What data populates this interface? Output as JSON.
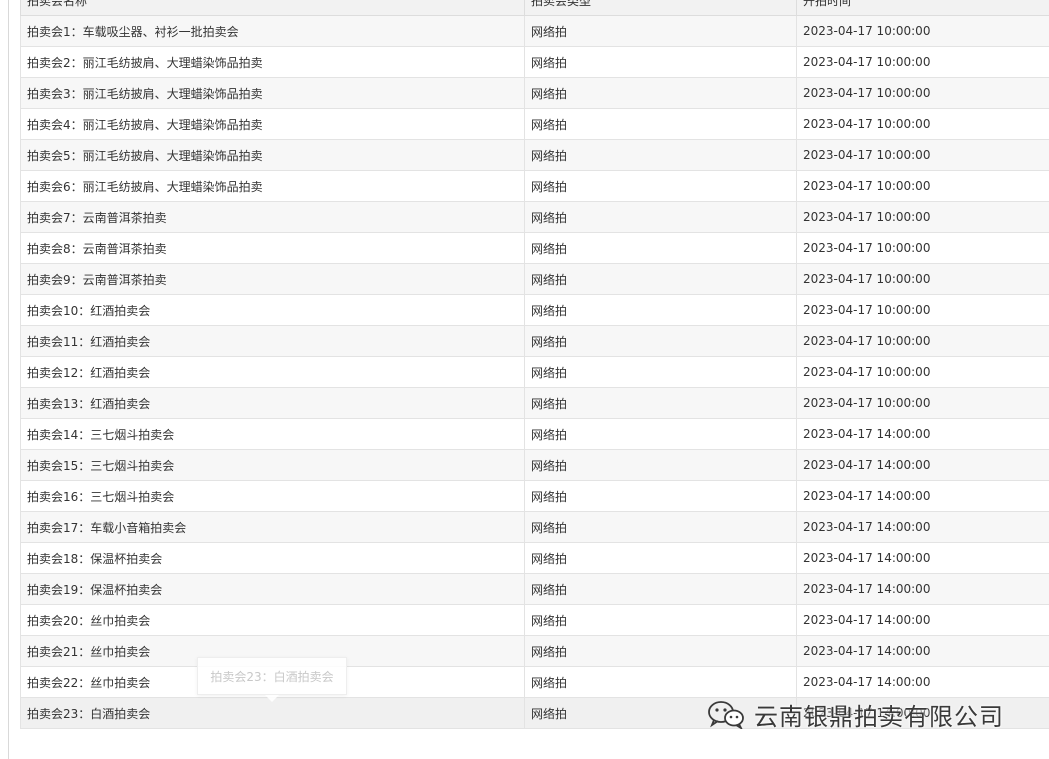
{
  "table": {
    "headers": [
      "拍卖会名称",
      "拍卖会类型",
      "开拍时间"
    ],
    "rows": [
      {
        "name": "拍卖会1：车载吸尘器、衬衫一批拍卖会",
        "type": "网络拍",
        "time": "2023-04-17 10:00:00"
      },
      {
        "name": "拍卖会2：丽江毛纺披肩、大理蜡染饰品拍卖",
        "type": "网络拍",
        "time": "2023-04-17 10:00:00"
      },
      {
        "name": "拍卖会3：丽江毛纺披肩、大理蜡染饰品拍卖",
        "type": "网络拍",
        "time": "2023-04-17 10:00:00"
      },
      {
        "name": "拍卖会4：丽江毛纺披肩、大理蜡染饰品拍卖",
        "type": "网络拍",
        "time": "2023-04-17 10:00:00"
      },
      {
        "name": "拍卖会5：丽江毛纺披肩、大理蜡染饰品拍卖",
        "type": "网络拍",
        "time": "2023-04-17 10:00:00"
      },
      {
        "name": "拍卖会6：丽江毛纺披肩、大理蜡染饰品拍卖",
        "type": "网络拍",
        "time": "2023-04-17 10:00:00"
      },
      {
        "name": "拍卖会7：云南普洱茶拍卖",
        "type": "网络拍",
        "time": "2023-04-17 10:00:00"
      },
      {
        "name": "拍卖会8：云南普洱茶拍卖",
        "type": "网络拍",
        "time": "2023-04-17 10:00:00"
      },
      {
        "name": "拍卖会9：云南普洱茶拍卖",
        "type": "网络拍",
        "time": "2023-04-17 10:00:00"
      },
      {
        "name": "拍卖会10：红酒拍卖会",
        "type": "网络拍",
        "time": "2023-04-17 10:00:00"
      },
      {
        "name": "拍卖会11：红酒拍卖会",
        "type": "网络拍",
        "time": "2023-04-17 10:00:00"
      },
      {
        "name": "拍卖会12：红酒拍卖会",
        "type": "网络拍",
        "time": "2023-04-17 10:00:00"
      },
      {
        "name": "拍卖会13：红酒拍卖会",
        "type": "网络拍",
        "time": "2023-04-17 10:00:00"
      },
      {
        "name": "拍卖会14：三七烟斗拍卖会",
        "type": "网络拍",
        "time": "2023-04-17 14:00:00"
      },
      {
        "name": "拍卖会15：三七烟斗拍卖会",
        "type": "网络拍",
        "time": "2023-04-17 14:00:00"
      },
      {
        "name": "拍卖会16：三七烟斗拍卖会",
        "type": "网络拍",
        "time": "2023-04-17 14:00:00"
      },
      {
        "name": "拍卖会17：车载小音箱拍卖会",
        "type": "网络拍",
        "time": "2023-04-17 14:00:00"
      },
      {
        "name": "拍卖会18：保温杯拍卖会",
        "type": "网络拍",
        "time": "2023-04-17 14:00:00"
      },
      {
        "name": "拍卖会19：保温杯拍卖会",
        "type": "网络拍",
        "time": "2023-04-17 14:00:00"
      },
      {
        "name": "拍卖会20：丝巾拍卖会",
        "type": "网络拍",
        "time": "2023-04-17 14:00:00"
      },
      {
        "name": "拍卖会21：丝巾拍卖会",
        "type": "网络拍",
        "time": "2023-04-17 14:00:00"
      },
      {
        "name": "拍卖会22：丝巾拍卖会",
        "type": "网络拍",
        "time": "2023-04-17 14:00:00"
      },
      {
        "name": "拍卖会23：白酒拍卖会",
        "type": "网络拍",
        "time": "2023-04-17 14:00:00"
      }
    ]
  },
  "tooltip": {
    "text": "拍卖会23：白酒拍卖会"
  },
  "watermark": {
    "text": "云南银鼎拍卖有限公司",
    "icon": "wechat-icon"
  }
}
